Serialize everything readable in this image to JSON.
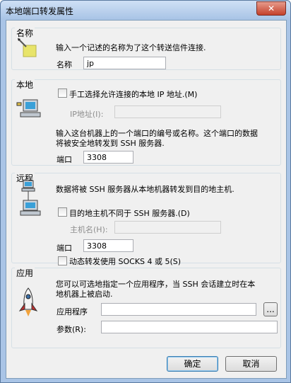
{
  "window": {
    "title": "本地端口转发属性",
    "close_glyph": "✕"
  },
  "name_section": {
    "title": "名称",
    "description": "输入一个记述的名称为了这个转送信件连接.",
    "field_label": "名称",
    "field_value": "jp"
  },
  "local_section": {
    "title": "本地",
    "manual_checkbox_label": "手工选择允许连接的本地 IP 地址.(M)",
    "ip_label": "IP地址(I):",
    "ip_value": "",
    "description_line1": "输入这台机器上的一个端口的编号或名称。这个端口的数据",
    "description_line2": "将被安全地转发到 SSH 服务器.",
    "port_label": "端口",
    "port_value": "3308"
  },
  "remote_section": {
    "title": "远程",
    "description": "数据将被 SSH 服务器从本地机器转发到目的地主机.",
    "dest_checkbox_label": "目的地主机不同于 SSH 服务器.(D)",
    "host_label": "主机名(H):",
    "host_value": "",
    "port_label": "端口",
    "port_value": "3308",
    "socks_checkbox_label": "动态转发使用 SOCKS 4 或 5(S)"
  },
  "app_section": {
    "title": "应用",
    "description_line1": "您可以可选地指定一个应用程序，当 SSH 会话建立时在本",
    "description_line2": "地机器上被启动.",
    "program_label": "应用程序",
    "program_value": "",
    "browse_label": "...",
    "params_label": "参数(R):",
    "params_value": ""
  },
  "buttons": {
    "ok": "确定",
    "cancel": "取消"
  },
  "icons": {
    "name": "pencil-note-icon",
    "local": "computer-icon",
    "remote": "network-computers-icon",
    "app": "rocket-icon",
    "close": "close-icon"
  }
}
